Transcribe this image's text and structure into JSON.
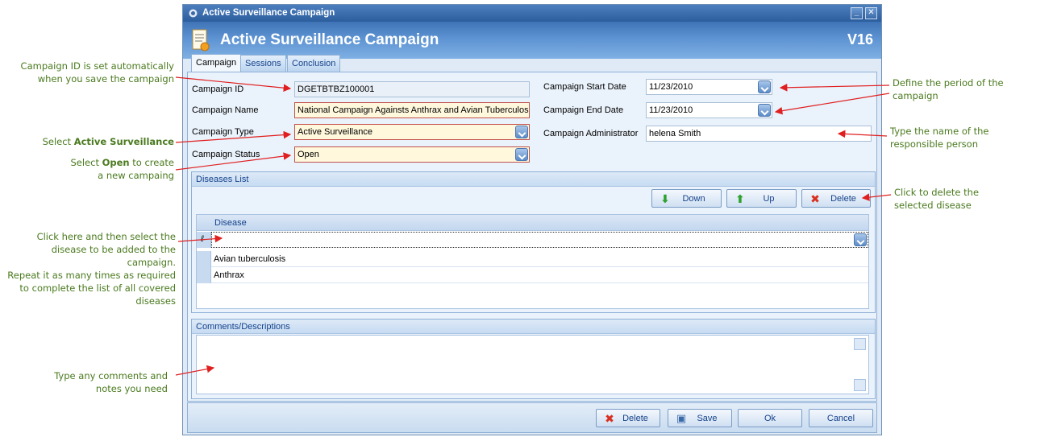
{
  "window": {
    "title": "Active Surveillance Campaign",
    "header_title": "Active Surveillance Campaign",
    "version": "V16"
  },
  "tabs": [
    {
      "label": "Campaign"
    },
    {
      "label": "Sessions"
    },
    {
      "label": "Conclusion"
    }
  ],
  "form": {
    "campaign_id_label": "Campaign ID",
    "campaign_id_value": "DGETBTBZ100001",
    "campaign_name_label": "Campaign Name",
    "campaign_name_value": "National Campaign Againsts Anthrax and Avian Tuberculos",
    "campaign_type_label": "Campaign Type",
    "campaign_type_value": "Active Surveillance",
    "campaign_status_label": "Campaign Status",
    "campaign_status_value": "Open",
    "start_date_label": "Campaign Start Date",
    "start_date_value": "11/23/2010",
    "end_date_label": "Campaign End Date",
    "end_date_value": "11/23/2010",
    "admin_label": "Campaign Administrator",
    "admin_value": "helena Smith"
  },
  "diseases": {
    "group_title": "Diseases List",
    "down_label": "Down",
    "up_label": "Up",
    "delete_label": "Delete",
    "column_header": "Disease",
    "rows": [
      "Avian tuberculosis",
      "Anthrax"
    ]
  },
  "comments": {
    "group_title": "Comments/Descriptions"
  },
  "footer": {
    "delete_label": "Delete",
    "save_label": "Save",
    "ok_label": "Ok",
    "cancel_label": "Cancel"
  },
  "annotations": {
    "campaign_id_l1": "Campaign ID is set automatically",
    "campaign_id_l2": "when you save the campaign",
    "type_prefix": "Select ",
    "type_bold": "Active Surveillance",
    "status_prefix": "Select ",
    "status_bold": "Open",
    "status_suffix": " to create",
    "status_l2": "a new campaing",
    "disease_l1": "Click here and then select the",
    "disease_l2": "disease to be added to the campaign.",
    "disease_l3": "Repeat it as many times as required",
    "disease_l4": "to complete the list of all covered",
    "disease_l5": "diseases",
    "comments_l1": "Type any comments and",
    "comments_l2": "notes you need",
    "period_l1": "Define the period of the",
    "period_l2": "campaign",
    "admin_l1": "Type the name of the",
    "admin_l2": "responsible person",
    "delete_l1": "Click to delete the",
    "delete_l2": "selected disease"
  },
  "colors": {
    "annotation_text": "#4a7a1e",
    "arrow": "#e02020",
    "header_blue": "#3f74b6",
    "required_border": "#c0504d"
  }
}
